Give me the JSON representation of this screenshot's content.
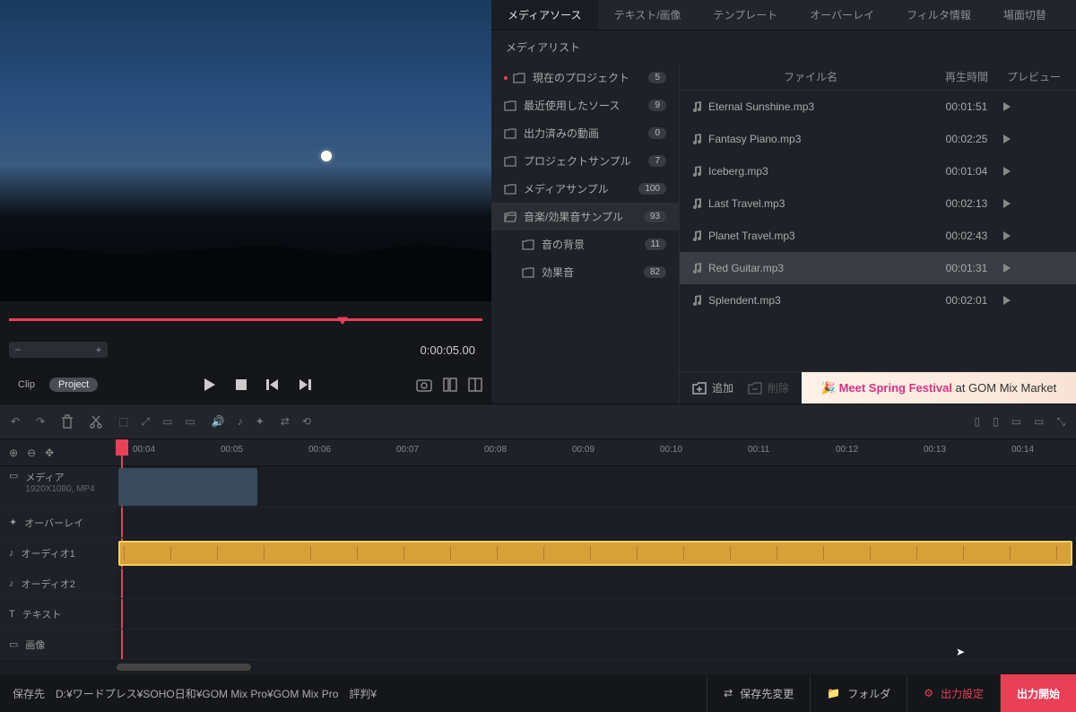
{
  "tabs": [
    "メディアソース",
    "テキスト/画像",
    "テンプレート",
    "オーバーレイ",
    "フィルタ情報",
    "場面切替"
  ],
  "media_list_label": "メディアリスト",
  "tree": [
    {
      "label": "現在のプロジェクト",
      "count": "5",
      "dot": true
    },
    {
      "label": "最近使用したソース",
      "count": "9"
    },
    {
      "label": "出力済みの動画",
      "count": "0"
    },
    {
      "label": "プロジェクトサンプル",
      "count": "7"
    },
    {
      "label": "メディアサンプル",
      "count": "100"
    },
    {
      "label": "音楽/効果音サンプル",
      "count": "93",
      "open": true
    },
    {
      "label": "音の背景",
      "count": "11",
      "sub": true
    },
    {
      "label": "効果音",
      "count": "82",
      "sub": true
    }
  ],
  "file_header": {
    "name": "ファイル名",
    "dur": "再生時間",
    "prev": "プレビュー"
  },
  "files": [
    {
      "name": "Eternal Sunshine.mp3",
      "dur": "00:01:51"
    },
    {
      "name": "Fantasy Piano.mp3",
      "dur": "00:02:25"
    },
    {
      "name": "Iceberg.mp3",
      "dur": "00:01:04"
    },
    {
      "name": "Last Travel.mp3",
      "dur": "00:02:13"
    },
    {
      "name": "Planet Travel.mp3",
      "dur": "00:02:43"
    },
    {
      "name": "Red Guitar.mp3",
      "dur": "00:01:31",
      "sel": true
    },
    {
      "name": "Splendent.mp3",
      "dur": "00:02:01"
    }
  ],
  "add_label": "追加",
  "delete_label": "削除",
  "banner": {
    "bold": "Meet Spring Festival",
    "rest": " at GOM Mix Market"
  },
  "timecode": "0:00:05.00",
  "clip_label": "Clip",
  "project_label": "Project",
  "ruler_ticks": [
    "00:04",
    "00:05",
    "00:06",
    "00:07",
    "00:08",
    "00:09",
    "00:10",
    "00:11",
    "00:12",
    "00:13",
    "00:14"
  ],
  "tracks": {
    "media": "メディア",
    "media_info": "1920X1080, MP4",
    "overlay": "オーバーレイ",
    "audio1": "オーディオ1",
    "audio2": "オーディオ2",
    "text": "テキスト",
    "image": "画像"
  },
  "footer": {
    "save_label": "保存先",
    "path": "D:¥ワードプレス¥SOHO日和¥GOM Mix Pro¥GOM Mix Pro　評判¥",
    "change": "保存先変更",
    "folder": "フォルダ",
    "out_setting": "出力設定",
    "start": "出力開始"
  }
}
